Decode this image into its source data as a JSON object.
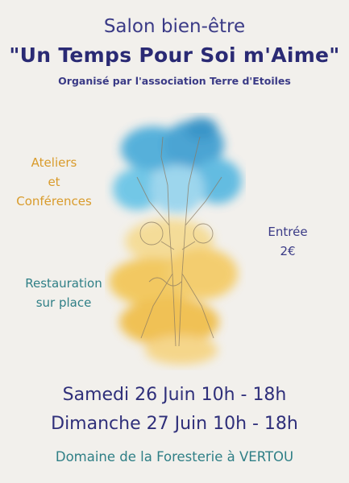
{
  "poster": {
    "title_line1": "Salon bien-être",
    "title_line2": "\"Un Temps Pour Soi m'Aime\"",
    "organizer": "Organisé par l'association Terre d'Etoiles",
    "workshops": [
      "Ateliers",
      "et",
      "Conférences"
    ],
    "catering": [
      "Restauration",
      "sur place"
    ],
    "entry": [
      "Entrée",
      "2€"
    ],
    "dates": [
      "Samedi 26 Juin 10h - 18h",
      "Dimanche 27 Juin 10h - 18h"
    ],
    "venue": "Domaine de la Foresterie à VERTOU"
  },
  "colors": {
    "navy": "#2f2f7a",
    "orange": "#d99b2b",
    "teal": "#2f7f86",
    "watercolor_blue": "#3aa6d8",
    "watercolor_yellow": "#f2c24a",
    "background": "#f2f0ec"
  },
  "artwork": {
    "icon": "watercolor-tree-illustration"
  }
}
